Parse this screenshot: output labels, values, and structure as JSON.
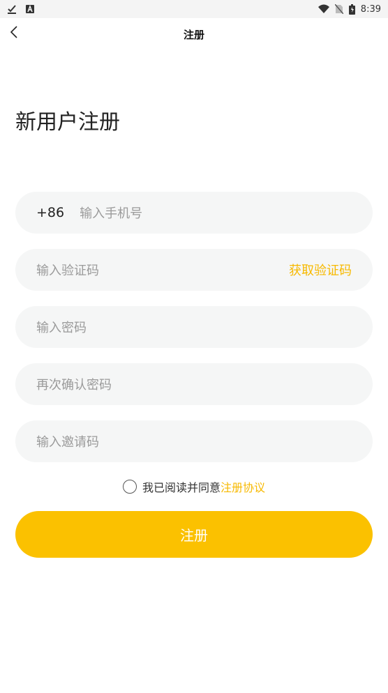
{
  "status_bar": {
    "time": "8:39",
    "battery_icon_text": "B"
  },
  "nav": {
    "title": "注册"
  },
  "heading": "新用户注册",
  "form": {
    "phone": {
      "prefix": "+86",
      "placeholder": "输入手机号"
    },
    "code": {
      "placeholder": "输入验证码",
      "action_label": "获取验证码"
    },
    "password": {
      "placeholder": "输入密码"
    },
    "confirm_password": {
      "placeholder": "再次确认密码"
    },
    "invite_code": {
      "placeholder": "输入邀请码"
    }
  },
  "agreement": {
    "text": "我已阅读并同意",
    "link": "注册协议"
  },
  "submit_label": "注册",
  "colors": {
    "accent": "#fbc100",
    "link": "#f7b900",
    "field_bg": "#f5f6f6"
  }
}
